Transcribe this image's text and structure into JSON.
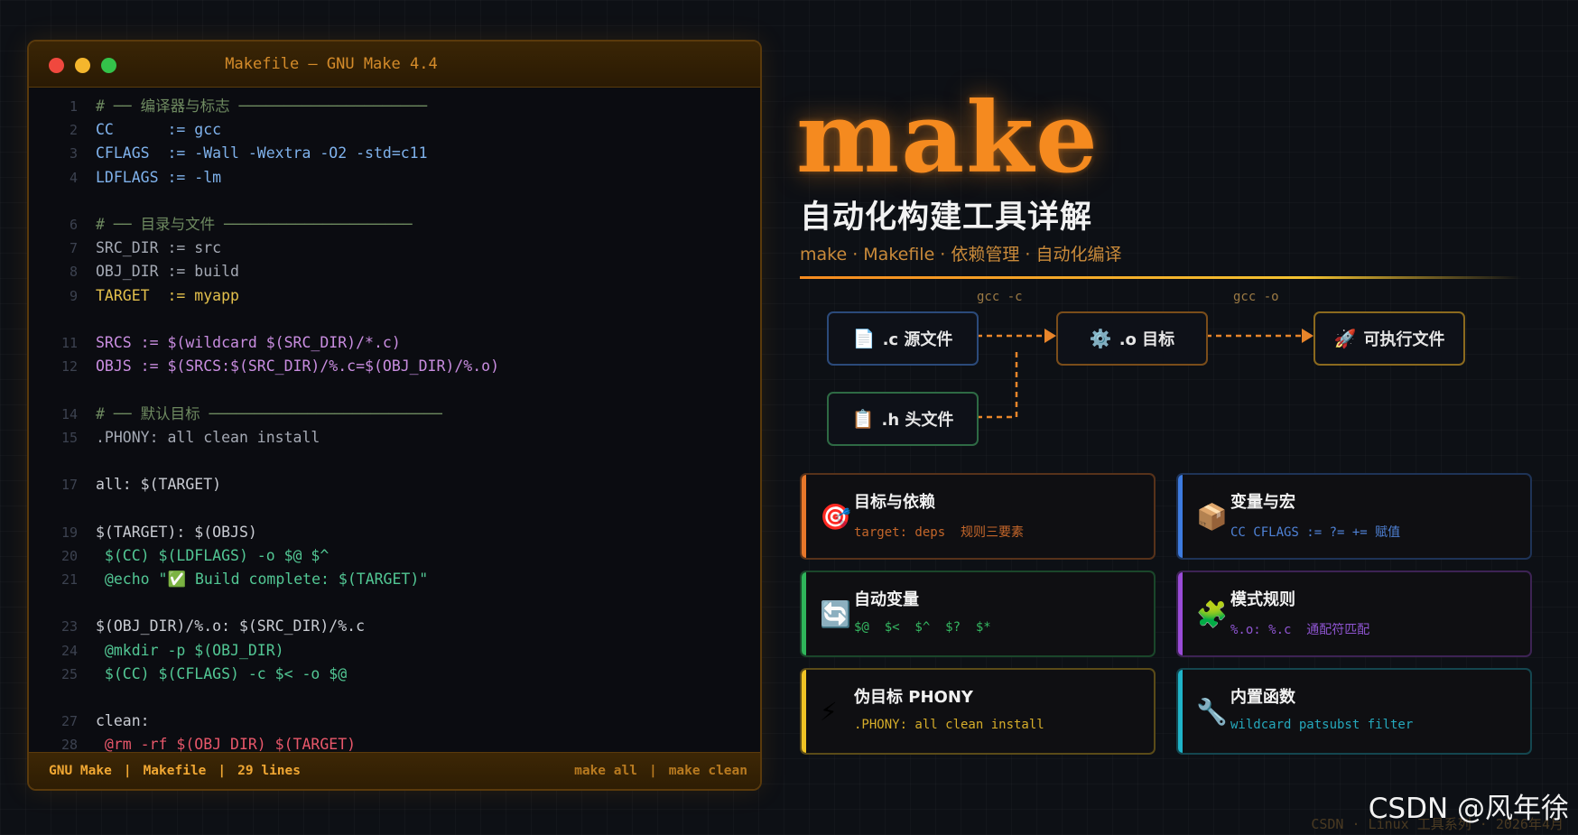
{
  "window": {
    "title": "Makefile  —  GNU Make 4.4",
    "controls": [
      "close",
      "minimize",
      "maximize"
    ]
  },
  "code_lines": [
    {
      "n": "1",
      "text": "# ── 编译器与标志 ─────────────────────",
      "kind": "c-comment"
    },
    {
      "n": "2",
      "text": "CC      := gcc",
      "kind": "c-var"
    },
    {
      "n": "3",
      "text": "CFLAGS  := -Wall -Wextra -O2 -std=c11",
      "kind": "c-var"
    },
    {
      "n": "4",
      "text": "LDFLAGS := -lm",
      "kind": "c-var"
    },
    {
      "n": "6",
      "text": "# ── 目录与文件 ─────────────────────",
      "kind": "c-comment"
    },
    {
      "n": "7",
      "text": "SRC_DIR := src",
      "kind": "c-phony"
    },
    {
      "n": "8",
      "text": "OBJ_DIR := build",
      "kind": "c-phony"
    },
    {
      "n": "9",
      "text": "TARGET  := myapp",
      "kind": "c-target"
    },
    {
      "n": "11",
      "text": "SRCS := $(wildcard $(SRC_DIR)/*.c)",
      "kind": "c-auto"
    },
    {
      "n": "12",
      "text": "OBJS := $(SRCS:$(SRC_DIR)/%.c=$(OBJ_DIR)/%.o)",
      "kind": "c-auto"
    },
    {
      "n": "14",
      "text": "# ── 默认目标 ──────────────────────────",
      "kind": "c-comment"
    },
    {
      "n": "15",
      "text": ".PHONY: all clean install",
      "kind": "c-phony"
    },
    {
      "n": "17",
      "text": "all: $(TARGET)",
      "kind": "c-plain"
    },
    {
      "n": "19",
      "text": "$(TARGET): $(OBJS)",
      "kind": "c-plain"
    },
    {
      "n": "20",
      "text": " $(CC) $(LDFLAGS) -o $@ $^",
      "kind": "c-cmd"
    },
    {
      "n": "21",
      "text": " @echo \"✅ Build complete: $(TARGET)\"",
      "kind": "c-cmd"
    },
    {
      "n": "23",
      "text": "$(OBJ_DIR)/%.o: $(SRC_DIR)/%.c",
      "kind": "c-plain"
    },
    {
      "n": "24",
      "text": " @mkdir -p $(OBJ_DIR)",
      "kind": "c-cmd"
    },
    {
      "n": "25",
      "text": " $(CC) $(CFLAGS) -c $< -o $@",
      "kind": "c-cmd"
    },
    {
      "n": "27",
      "text": "clean:",
      "kind": "c-plain"
    },
    {
      "n": "28",
      "text": " @rm -rf $(OBJ_DIR) $(TARGET)",
      "kind": "c-rm"
    }
  ],
  "statusbar": {
    "lang": "GNU Make",
    "file": "Makefile",
    "lines": "29 lines",
    "cmd1": "make all",
    "cmd2": "make clean",
    "sep": "|"
  },
  "hero": {
    "title": "make",
    "subtitle": "自动化构建工具详解",
    "tagline": "make · Makefile · 依赖管理 · 自动化编译"
  },
  "flow": {
    "label_compile": "gcc -c",
    "label_link": "gcc -o",
    "src": {
      "icon": "📄",
      "label": ".c 源文件"
    },
    "obj": {
      "icon": "⚙️",
      "label": ".o 目标"
    },
    "exe": {
      "icon": "🚀",
      "label": "可执行文件"
    },
    "hdr": {
      "icon": "📋",
      "label": ".h 头文件"
    }
  },
  "cards": {
    "targets": {
      "icon": "🎯",
      "title": "目标与依赖",
      "desc": "target: deps  规则三要素",
      "color": "#e8772a",
      "desc_color": "#c4662a"
    },
    "vars": {
      "icon": "📦",
      "title": "变量与宏",
      "desc": "CC CFLAGS := ?= += 赋值",
      "color": "#3d7be0",
      "desc_color": "#4f82d6"
    },
    "auto": {
      "icon": "🔄",
      "title": "自动变量",
      "desc": "$@  $<  $^  $?  $*",
      "color": "#2fb55a",
      "desc_color": "#35b862"
    },
    "pattern": {
      "icon": "🧩",
      "title": "模式规则",
      "desc": "%.o: %.c  通配符匹配",
      "color": "#9a4bd8",
      "desc_color": "#8f55d2"
    },
    "phony": {
      "icon": "⚡",
      "title": "伪目标 PHONY",
      "desc": ".PHONY: all clean install",
      "color": "#f0c324",
      "desc_color": "#d6ad2a"
    },
    "builtin": {
      "icon": "🔧",
      "title": "内置函数",
      "desc": "wildcard patsubst filter",
      "color": "#1fb4c9",
      "desc_color": "#25a8bc"
    }
  },
  "watermark": "CSDN @风年徐",
  "footer_note": "CSDN · Linux 工具系列 · 2026年4月"
}
